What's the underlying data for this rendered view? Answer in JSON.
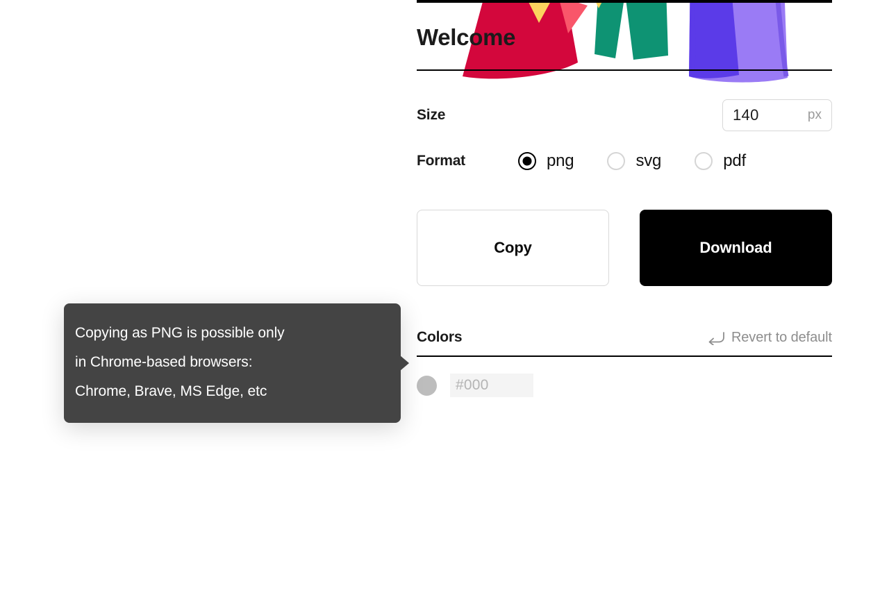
{
  "panel": {
    "title": "Welcome",
    "settings": {
      "size": {
        "label": "Size",
        "value": "140",
        "unit": "px"
      },
      "format": {
        "label": "Format",
        "options": [
          {
            "label": "png",
            "selected": true
          },
          {
            "label": "svg",
            "selected": false
          },
          {
            "label": "pdf",
            "selected": false
          }
        ]
      }
    },
    "actions": {
      "copy_label": "Copy",
      "download_label": "Download"
    },
    "colors": {
      "title": "Colors",
      "revert_label": "Revert to default",
      "revert_icon": "return-arrow-icon",
      "entries": [
        {
          "swatch_color": "#bdbdbd",
          "placeholder": "#000"
        }
      ]
    }
  },
  "tooltip": {
    "lines": [
      "Copying as PNG is possible only",
      "in Chrome-based browsers:",
      "Chrome, Brave, MS Edge, etc"
    ]
  },
  "illustration": {
    "name": "celebration-people-illustration",
    "colors": {
      "red": "#D3073C",
      "dark_green": "#0E9373",
      "mint_green": "#26C48E",
      "purple_dark": "#5B3BE8",
      "purple_light": "#9A7BF5",
      "yellow": "#FBD45E",
      "coral": "#F9566A",
      "orange": "#ED8B3C",
      "outline": "#111111"
    }
  },
  "theme": {
    "accent": "#000000",
    "rule": "#000000",
    "muted_text": "#8d8d8d",
    "tooltip_bg": "#444444"
  }
}
